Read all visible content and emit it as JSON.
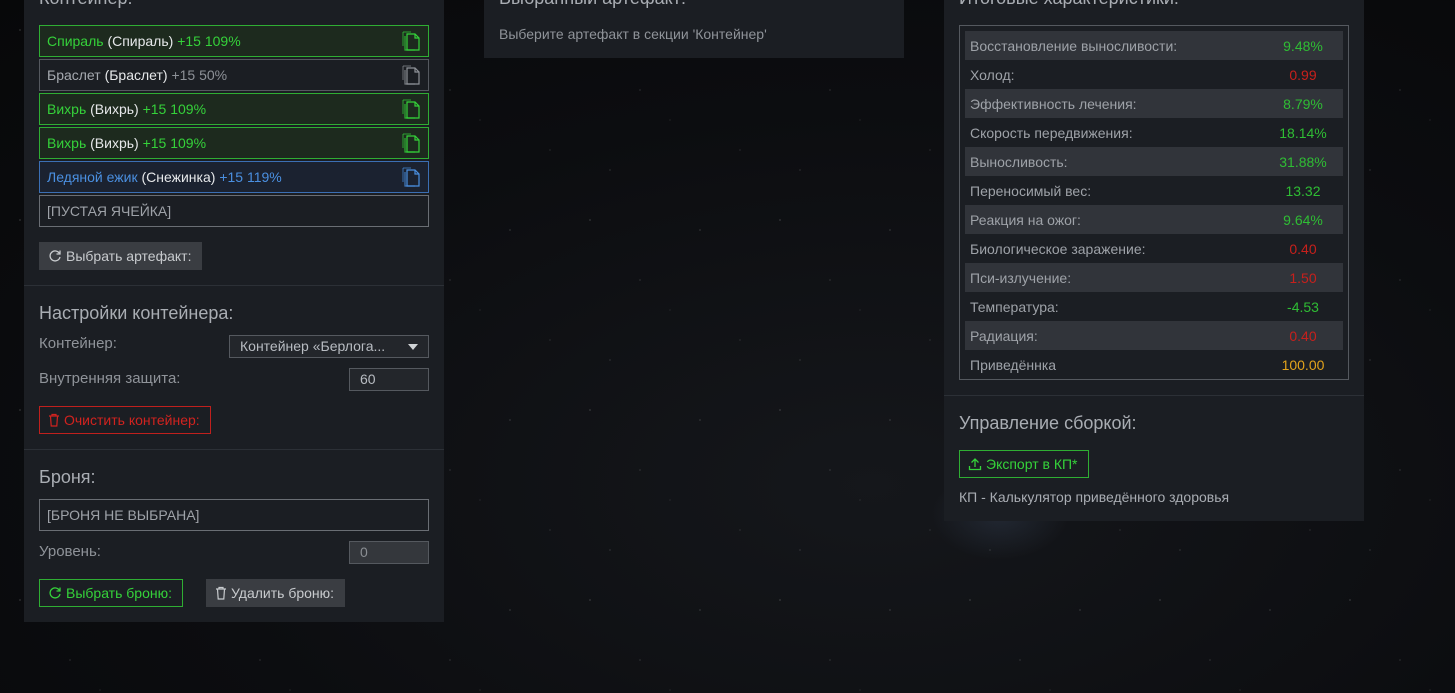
{
  "container": {
    "title": "Контейнер:",
    "slots": [
      {
        "name": "Спираль",
        "sub": "(Спираль)",
        "level": "+15 109%",
        "style": "green"
      },
      {
        "name": "Браслет",
        "sub": "(Браслет)",
        "level": "+15 50%",
        "style": "grey"
      },
      {
        "name": "Вихрь",
        "sub": "(Вихрь)",
        "level": "+15 109%",
        "style": "green"
      },
      {
        "name": "Вихрь",
        "sub": "(Вихрь)",
        "level": "+15 109%",
        "style": "green"
      },
      {
        "name": "Ледяной ежик",
        "sub": "(Снежинка)",
        "level": "+15 119%",
        "style": "blue"
      }
    ],
    "empty_slot": "[ПУСТАЯ ЯЧЕЙКА]",
    "select_button": "Выбрать артефакт:"
  },
  "settings": {
    "title": "Настройки контейнера:",
    "container_label": "Контейнер:",
    "container_value": "Контейнер «Берлога...",
    "protection_label": "Внутренняя защита:",
    "protection_value": "60",
    "clear_button": "Очистить контейнер:"
  },
  "armor": {
    "title": "Броня:",
    "slot": "[БРОНЯ НЕ ВЫБРАНА]",
    "level_label": "Уровень:",
    "level_value": "0",
    "select_button": "Выбрать броню:",
    "delete_button": "Удалить броню:"
  },
  "selected": {
    "title": "Выбранный артефакт:",
    "hint": "Выберите артефакт в секции 'Контейнер'"
  },
  "stats": {
    "title": "Итоговые характеристики:",
    "rows": [
      {
        "label": "Восстановление выносливости:",
        "value": "9.48%",
        "color": "green"
      },
      {
        "label": "Холод:",
        "value": "0.99",
        "color": "red"
      },
      {
        "label": "Эффективность лечения:",
        "value": "8.79%",
        "color": "green"
      },
      {
        "label": "Скорость передвижения:",
        "value": "18.14%",
        "color": "green"
      },
      {
        "label": "Выносливость:",
        "value": "31.88%",
        "color": "green"
      },
      {
        "label": "Переносимый вес:",
        "value": "13.32",
        "color": "green"
      },
      {
        "label": "Реакция на ожог:",
        "value": "9.64%",
        "color": "green"
      },
      {
        "label": "Биологическое заражение:",
        "value": "0.40",
        "color": "red"
      },
      {
        "label": "Пси-излучение:",
        "value": "1.50",
        "color": "red"
      },
      {
        "label": "Температура:",
        "value": "-4.53",
        "color": "green"
      },
      {
        "label": "Радиация:",
        "value": "0.40",
        "color": "red"
      },
      {
        "label": "Приведённка",
        "value": "100.00",
        "color": "yellow"
      }
    ]
  },
  "build": {
    "title": "Управление сборкой:",
    "export_button": "Экспорт в КП*",
    "note": "КП - Калькулятор приведённого здоровья"
  }
}
